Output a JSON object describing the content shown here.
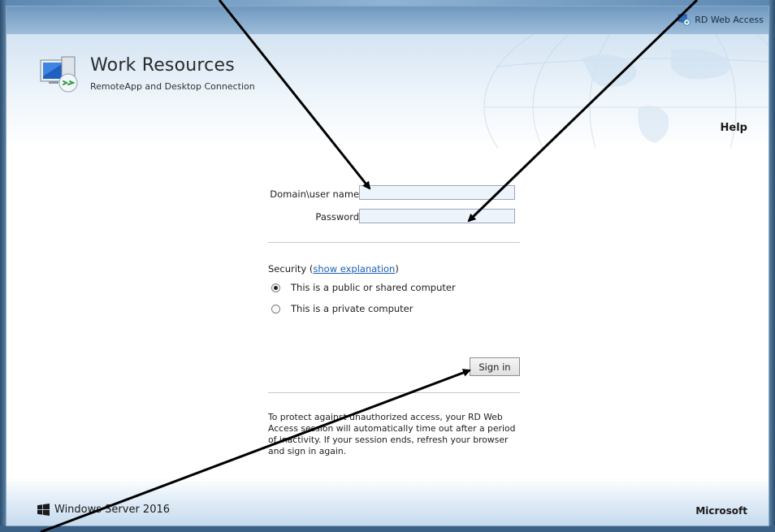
{
  "top_strip": {
    "link_label": "RD Web Access",
    "link_icon": "rd-web-access-icon"
  },
  "header": {
    "title": "Work Resources",
    "subtitle": "RemoteApp and Desktop Connection",
    "help_label": "Help",
    "logo_icon": "remote-desktop-computer-icon"
  },
  "form": {
    "username_label": "Domain\\user name:",
    "username_value": "",
    "password_label": "Password:",
    "password_value": "",
    "security_prefix": "Security (",
    "security_link": "show explanation",
    "security_suffix": ")",
    "radios": [
      {
        "label": "This is a public or shared computer",
        "checked": true
      },
      {
        "label": "This is a private computer",
        "checked": false
      }
    ],
    "signin_label": "Sign in",
    "notice": "To protect against unauthorized access, your RD Web Access session will automatically time out after a period of inactivity. If your session ends, refresh your browser and sign in again."
  },
  "footer": {
    "brand_label": "Windows Server 2016",
    "vendor_label": "Microsoft",
    "brand_icon": "windows-logo-icon"
  },
  "colors": {
    "accent_orange": "#f29a3c",
    "link_blue": "#1d5fb5",
    "input_fill": "#edf4fc",
    "frame_blue": "#3b6186"
  }
}
